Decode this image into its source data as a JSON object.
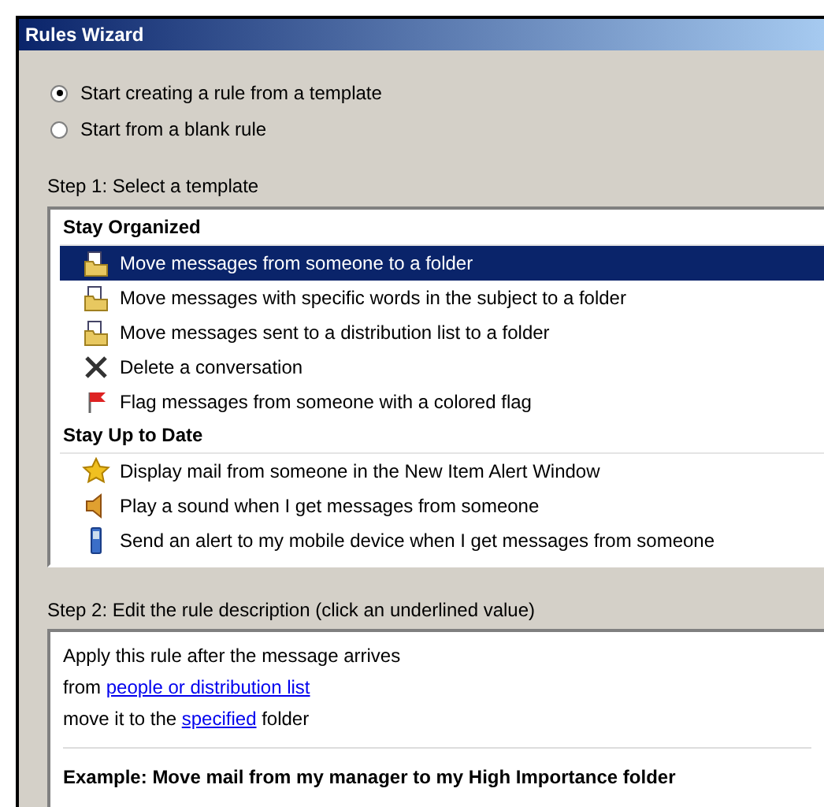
{
  "window": {
    "title": "Rules Wizard"
  },
  "start_options": [
    {
      "label": "Start creating a rule from a template",
      "selected": true
    },
    {
      "label": "Start from a blank rule",
      "selected": false
    }
  ],
  "step1": {
    "label": "Step 1: Select a template",
    "groups": [
      {
        "header": "Stay Organized",
        "items": [
          {
            "kind": "move",
            "label": "Move messages from someone to a folder",
            "selected": true
          },
          {
            "kind": "move",
            "label": "Move messages with specific words in the subject to a folder",
            "selected": false
          },
          {
            "kind": "move",
            "label": "Move messages sent to a distribution list to a folder",
            "selected": false
          },
          {
            "kind": "delete",
            "label": "Delete a conversation",
            "selected": false
          },
          {
            "kind": "flag",
            "label": "Flag messages from someone with a colored flag",
            "selected": false
          }
        ]
      },
      {
        "header": "Stay Up to Date",
        "items": [
          {
            "kind": "alert",
            "label": "Display mail from someone in the New Item Alert Window",
            "selected": false
          },
          {
            "kind": "sound",
            "label": "Play a sound when I get messages from someone",
            "selected": false
          },
          {
            "kind": "mobile",
            "label": "Send an alert to my mobile device when I get messages from someone",
            "selected": false
          }
        ]
      }
    ]
  },
  "step2": {
    "label": "Step 2: Edit the rule description (click an underlined value)",
    "lines": [
      [
        {
          "text": "Apply this rule after the message arrives",
          "link": false
        }
      ],
      [
        {
          "text": "from ",
          "link": false
        },
        {
          "text": "people or distribution list",
          "link": true
        }
      ],
      [
        {
          "text": "move it to the ",
          "link": false
        },
        {
          "text": "specified",
          "link": true
        },
        {
          "text": " folder",
          "link": false
        }
      ]
    ],
    "example": "Example: Move mail from my manager to my High Importance folder"
  }
}
